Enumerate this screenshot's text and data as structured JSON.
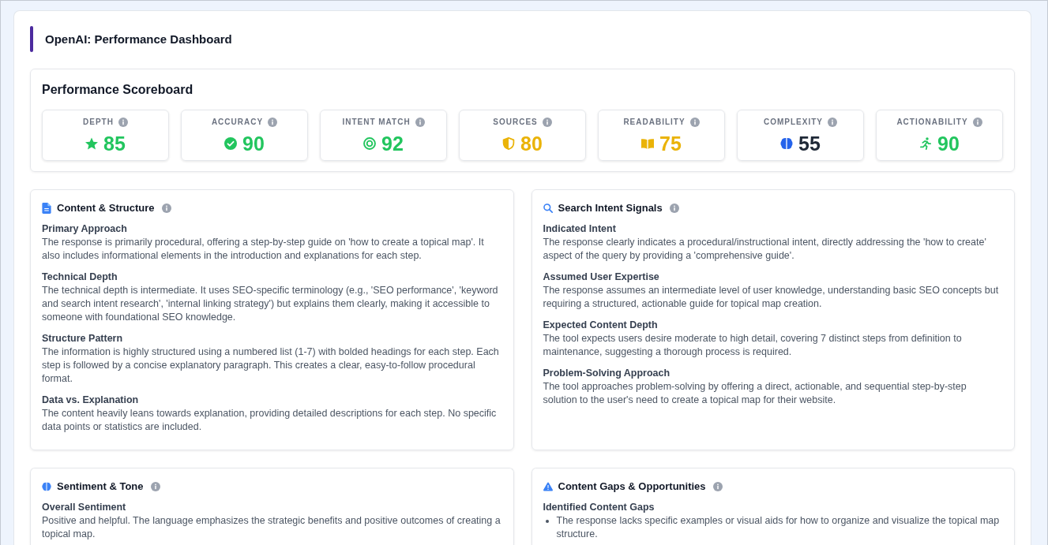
{
  "page": {
    "title": "OpenAI: Performance Dashboard"
  },
  "scoreboard": {
    "title": "Performance Scoreboard",
    "metrics": [
      {
        "label": "DEPTH",
        "value": "85",
        "color": "#22c55e"
      },
      {
        "label": "ACCURACY",
        "value": "90",
        "color": "#22c55e"
      },
      {
        "label": "INTENT MATCH",
        "value": "92",
        "color": "#22c55e"
      },
      {
        "label": "SOURCES",
        "value": "80",
        "color": "#eab308"
      },
      {
        "label": "READABILITY",
        "value": "75",
        "color": "#eab308"
      },
      {
        "label": "COMPLEXITY",
        "value": "55",
        "color": "#1f2937"
      },
      {
        "label": "ACTIONABILITY",
        "value": "90",
        "color": "#22c55e"
      }
    ]
  },
  "panels": [
    {
      "title": "Content & Structure",
      "sections": [
        {
          "kind": "text",
          "heading": "Primary Approach",
          "text": "The response is primarily procedural, offering a step-by-step guide on 'how to create a topical map'. It also includes informational elements in the introduction and explanations for each step."
        },
        {
          "kind": "text",
          "heading": "Technical Depth",
          "text": "The technical depth is intermediate. It uses SEO-specific terminology (e.g., 'SEO performance', 'keyword and search intent research', 'internal linking strategy') but explains them clearly, making it accessible to someone with foundational SEO knowledge."
        },
        {
          "kind": "text",
          "heading": "Structure Pattern",
          "text": "The information is highly structured using a numbered list (1-7) with bolded headings for each step. Each step is followed by a concise explanatory paragraph. This creates a clear, easy-to-follow procedural format."
        },
        {
          "kind": "text",
          "heading": "Data vs. Explanation",
          "text": "The content heavily leans towards explanation, providing detailed descriptions for each step. No specific data points or statistics are included."
        }
      ]
    },
    {
      "title": "Search Intent Signals",
      "sections": [
        {
          "kind": "text",
          "heading": "Indicated Intent",
          "text": "The response clearly indicates a procedural/instructional intent, directly addressing the 'how to create' aspect of the query by providing a 'comprehensive guide'."
        },
        {
          "kind": "text",
          "heading": "Assumed User Expertise",
          "text": "The response assumes an intermediate level of user knowledge, understanding basic SEO concepts but requiring a structured, actionable guide for topical map creation."
        },
        {
          "kind": "text",
          "heading": "Expected Content Depth",
          "text": "The tool expects users desire moderate to high detail, covering 7 distinct steps from definition to maintenance, suggesting a thorough process is required."
        },
        {
          "kind": "text",
          "heading": "Problem-Solving Approach",
          "text": "The tool approaches problem-solving by offering a direct, actionable, and sequential step-by-step solution to the user's need to create a topical map for their website."
        }
      ]
    },
    {
      "title": "Sentiment & Tone",
      "sections": [
        {
          "kind": "text",
          "heading": "Overall Sentiment",
          "text": "Positive and helpful. The language emphasizes the strategic benefits and positive outcomes of creating a topical map."
        }
      ]
    },
    {
      "title": "Content Gaps & Opportunities",
      "sections": [
        {
          "kind": "list",
          "heading": "Identified Content Gaps",
          "items": [
            "The response lacks specific examples or visual aids for how to organize and visualize the topical map structure."
          ]
        }
      ]
    }
  ]
}
